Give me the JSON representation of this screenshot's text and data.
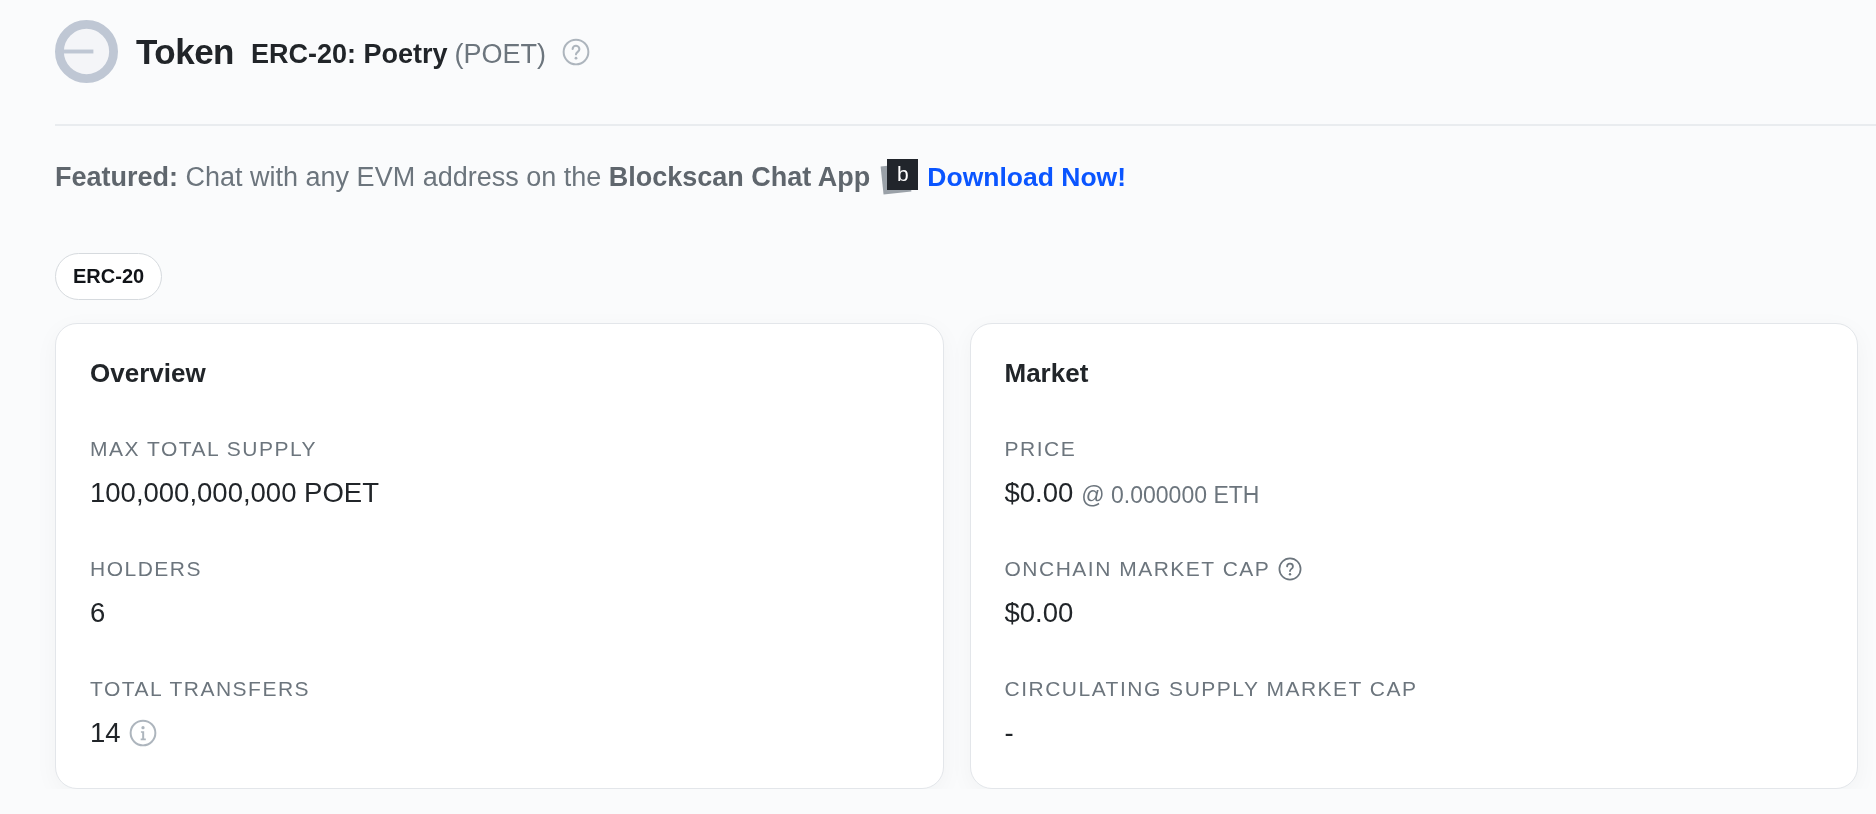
{
  "header": {
    "title": "Token",
    "token_name": "ERC-20: Poetry",
    "symbol": "(POET)"
  },
  "featured": {
    "text": "**Featured:** Chat with any EVM address on the **Blockscan Chat App**",
    "logo_letter": "b",
    "link": "Download Now!"
  },
  "badges": [
    {
      "label": "ERC-20"
    }
  ],
  "cards": [
    {
      "title": "Overview",
      "items": [
        {
          "label": "MAX TOTAL SUPPLY",
          "value": "100,000,000,000 POET"
        },
        {
          "label": "HOLDERS",
          "value": "6"
        },
        {
          "label": "TOTAL TRANSFERS",
          "value": "14",
          "value_info": true
        }
      ]
    },
    {
      "title": "Market",
      "items": [
        {
          "label": "PRICE",
          "value": "$0.00",
          "note": "@ 0.000000 ETH"
        },
        {
          "label": "ONCHAIN MARKET CAP",
          "label_hint": true,
          "value": "$0.00"
        },
        {
          "label": "CIRCULATING SUPPLY MARKET CAP",
          "value": "-"
        }
      ]
    }
  ]
}
